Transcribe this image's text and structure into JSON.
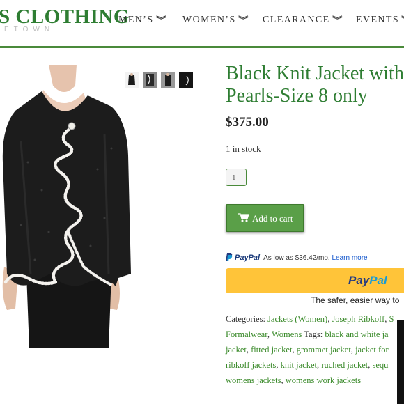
{
  "header": {
    "logo": "S CLOTHING",
    "logo_sub": "ETOWN",
    "nav": [
      {
        "label": "MEN’S"
      },
      {
        "label": "WOMEN’S"
      },
      {
        "label": "CLEARANCE"
      },
      {
        "label": "EVENTS"
      }
    ]
  },
  "product": {
    "title_line1": "Black Knit Jacket with I",
    "title_line2": "Pearls-Size 8 only",
    "price": "$375.00",
    "stock": "1 in stock",
    "quantity": "1",
    "add_to_cart": "Add to cart"
  },
  "paypal": {
    "brand": "PayPal",
    "offer": "As low as $36.42/mo.",
    "learn_more": "Learn more",
    "button_pay": "Pay",
    "button_pal": "Pal",
    "tagline": "The safer, easier way to"
  },
  "meta": {
    "categories_label": "Categories:",
    "cat_jackets": "Jackets (Women)",
    "cat_ribkoff": "Joseph Ribkoff",
    "cat_trunc": "S",
    "cat_formalwear": "Formalwear",
    "cat_womens": "Womens",
    "tags_label": "Tags:",
    "tag_bw": "black and white ja",
    "tag_jacket": "jacket",
    "tag_fitted": "fitted jacket",
    "tag_grommet": "grommet jacket",
    "tag_jacketfor": "jacket for",
    "tag_ribkoff_jackets": "ribkoff jackets",
    "tag_knit": "knit jacket",
    "tag_ruched": "ruched jacket",
    "tag_sequ": "sequ",
    "tag_womens_jackets": "womens jackets",
    "tag_womens_work": "womens work jackets"
  },
  "colors": {
    "brand_green": "#2e7d32",
    "button_green": "#5a9f48",
    "paypal_yellow": "#ffc439",
    "paypal_blue": "#253b80"
  },
  "icons": [
    "chevron-down-double-icon",
    "cart-icon",
    "paypal-logo-icon"
  ]
}
